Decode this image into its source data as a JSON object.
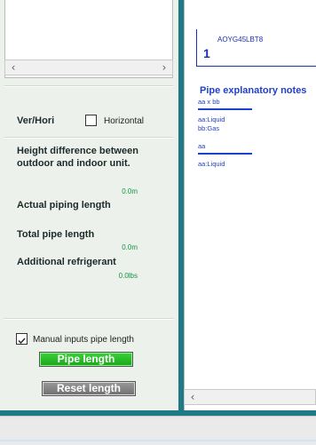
{
  "left_panel": {
    "ver_hori_label": "Ver/Hori",
    "horizontal_label": "Horizontal",
    "height_diff_label_line1": "Height difference between",
    "height_diff_label_line2": "outdoor and indoor unit.",
    "height_diff_value": "0.0m",
    "actual_piping_label": "Actual piping length",
    "total_pipe_label": "Total pipe length",
    "total_pipe_value": "0.0m",
    "additional_refrigerant_label": "Additional refrigerant",
    "additional_refrigerant_value": "0.0lbs",
    "manual_inputs_label": "Manual inputs pipe length",
    "manual_inputs_checked": true,
    "horizontal_checked": false,
    "pipe_length_button": "Pipe length",
    "reset_length_button": "Reset length"
  },
  "right_panel": {
    "unit_model": "AOYG45LBT8",
    "unit_number": "1",
    "notes_title": "Pipe explanatory notes",
    "notes": [
      {
        "text": "aa x bb",
        "underline": true
      },
      {
        "text": "aa:Liquid"
      },
      {
        "text": "bb:Gas"
      },
      {
        "text": "aa",
        "underline": true
      },
      {
        "text": "aa:Liquid"
      }
    ]
  },
  "colors": {
    "accent_blue": "#1f3fcf",
    "value_green": "#0e9a40",
    "pipe_button_green": "#17a617",
    "window_teal": "#1e7b86"
  }
}
